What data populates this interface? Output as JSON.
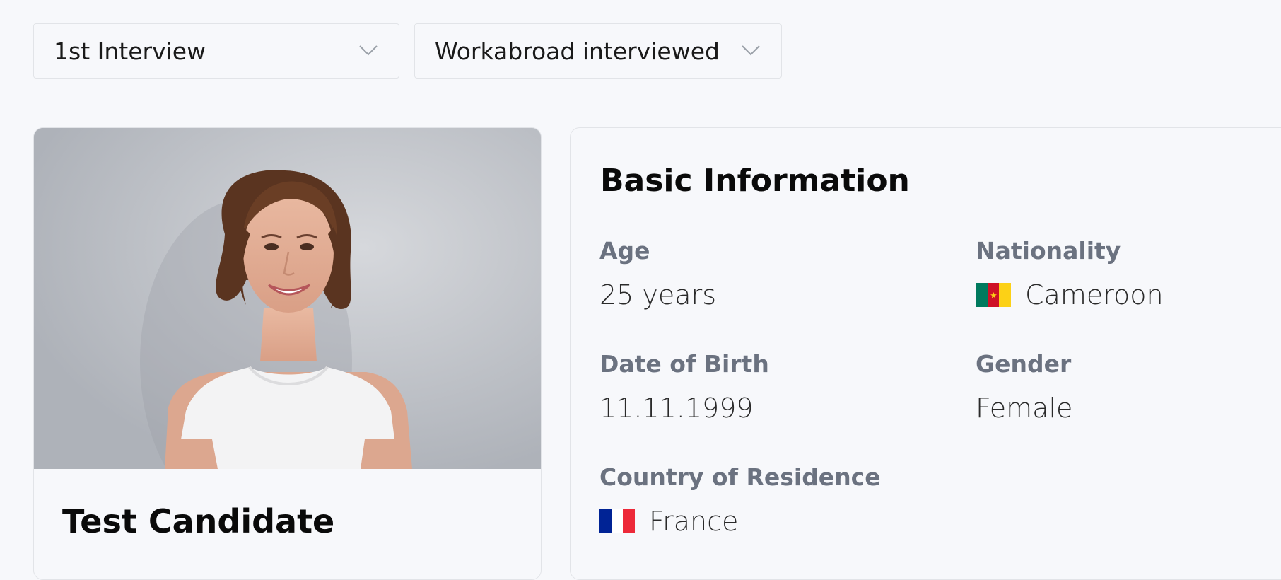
{
  "filters": {
    "stage": {
      "value": "1st Interview"
    },
    "status": {
      "value": "Workabroad interviewed"
    }
  },
  "candidate": {
    "name": "Test Candidate"
  },
  "basic_info": {
    "title": "Basic Information",
    "age": {
      "label": "Age",
      "value": "25 years"
    },
    "nationality": {
      "label": "Nationality",
      "value": "Cameroon",
      "flag_icon": "cameroon-flag-icon",
      "flag_colors": [
        "#007a5e",
        "#ce1126",
        "#fcd116"
      ]
    },
    "date_of_birth": {
      "label": "Date of Birth",
      "value": "11.11.1999"
    },
    "gender": {
      "label": "Gender",
      "value": "Female"
    },
    "country_of_residence": {
      "label": "Country of Residence",
      "value": "France",
      "flag_icon": "france-flag-icon",
      "flag_colors": [
        "#002395",
        "#ffffff",
        "#ed2939"
      ]
    }
  },
  "colors": {
    "page_background": "#f7f8fb",
    "border": "#e2e4e8",
    "label_gray": "#6b7280"
  }
}
